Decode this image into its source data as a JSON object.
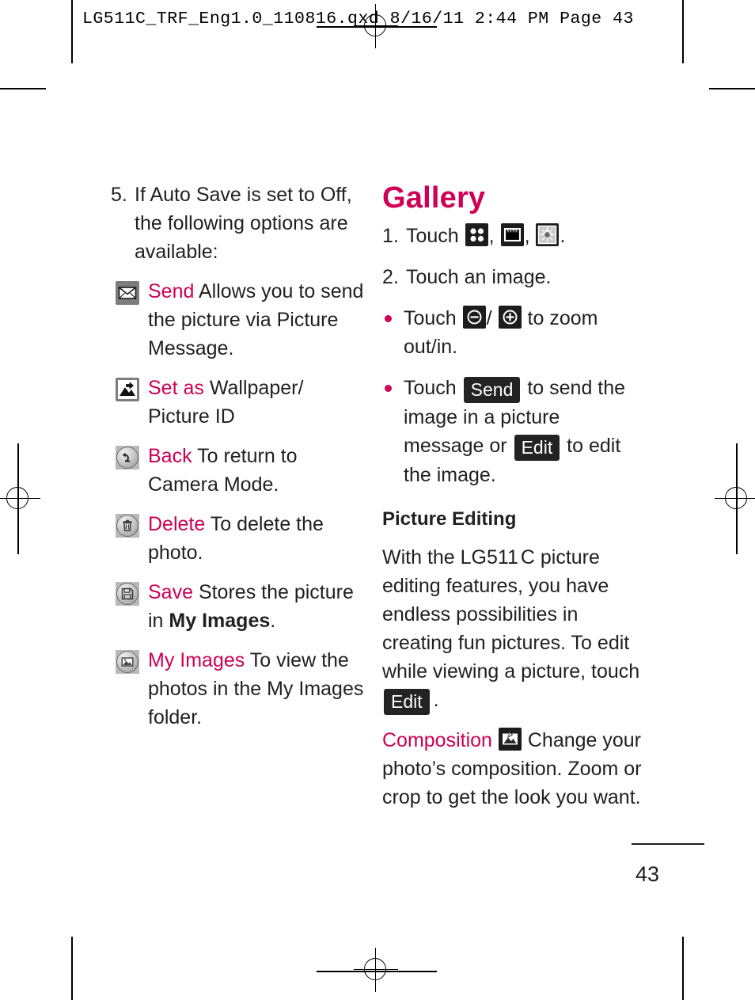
{
  "header": {
    "filename_line": "LG511C_TRF_Eng1.0_110816.qxd   8/16/11   2:44 PM   Page 43"
  },
  "left_column": {
    "step": {
      "number": "5.",
      "text": "If Auto Save is set to Off, the following options are available:"
    },
    "options": [
      {
        "icon": "envelope-icon",
        "term": "Send",
        "description": "Allows you to send the picture via Picture Message."
      },
      {
        "icon": "set-as-wallpaper-icon",
        "term": "Set as",
        "description": "Wallpaper/ Picture ID"
      },
      {
        "icon": "back-arrow-icon",
        "term": "Back",
        "description": "To return to Camera Mode."
      },
      {
        "icon": "trash-icon",
        "term": "Delete",
        "description": "To delete the photo."
      },
      {
        "icon": "save-floppy-icon",
        "term": "Save",
        "description_before": "Stores the picture in",
        "description_bold": "My Images",
        "description_after": "."
      },
      {
        "icon": "my-images-icon",
        "term": "My Images",
        "description": "To view the photos in the My Images folder."
      }
    ]
  },
  "right_column": {
    "heading": "Gallery",
    "step1": {
      "number": "1.",
      "text_before": "Touch",
      "icons": [
        "grid-dots-icon",
        "media-film-icon",
        "photo-flower-icon"
      ],
      "separator": ",",
      "text_after": "."
    },
    "step2": {
      "number": "2.",
      "text": "Touch an image."
    },
    "bullets": [
      {
        "text_before": "Touch",
        "icon_out": "zoom-out-icon",
        "divider": "/",
        "icon_in": "zoom-in-icon",
        "text_after": "to zoom out/in."
      },
      {
        "text_before": "Touch",
        "chip_send": "Send",
        "text_middle": "to send the image in a picture message or",
        "chip_edit": "Edit",
        "text_after": "to edit the image."
      }
    ],
    "picture_editing": {
      "heading": "Picture Editing",
      "body_before": "With the LG511",
      "body_model_suffix": "C",
      "body_middle": "picture editing features, you have endless possibilities in creating fun pictures. To edit while viewing a picture, touch",
      "chip_edit": "Edit",
      "body_after": "."
    },
    "composition": {
      "term": "Composition",
      "icon": "composition-icon",
      "description": "Change your photo’s composition. Zoom or crop to get the look you want."
    }
  },
  "footer": {
    "page_number": "43"
  },
  "colors": {
    "accent": "#cf0055",
    "text": "#231f20",
    "chip_background": "#232323"
  }
}
